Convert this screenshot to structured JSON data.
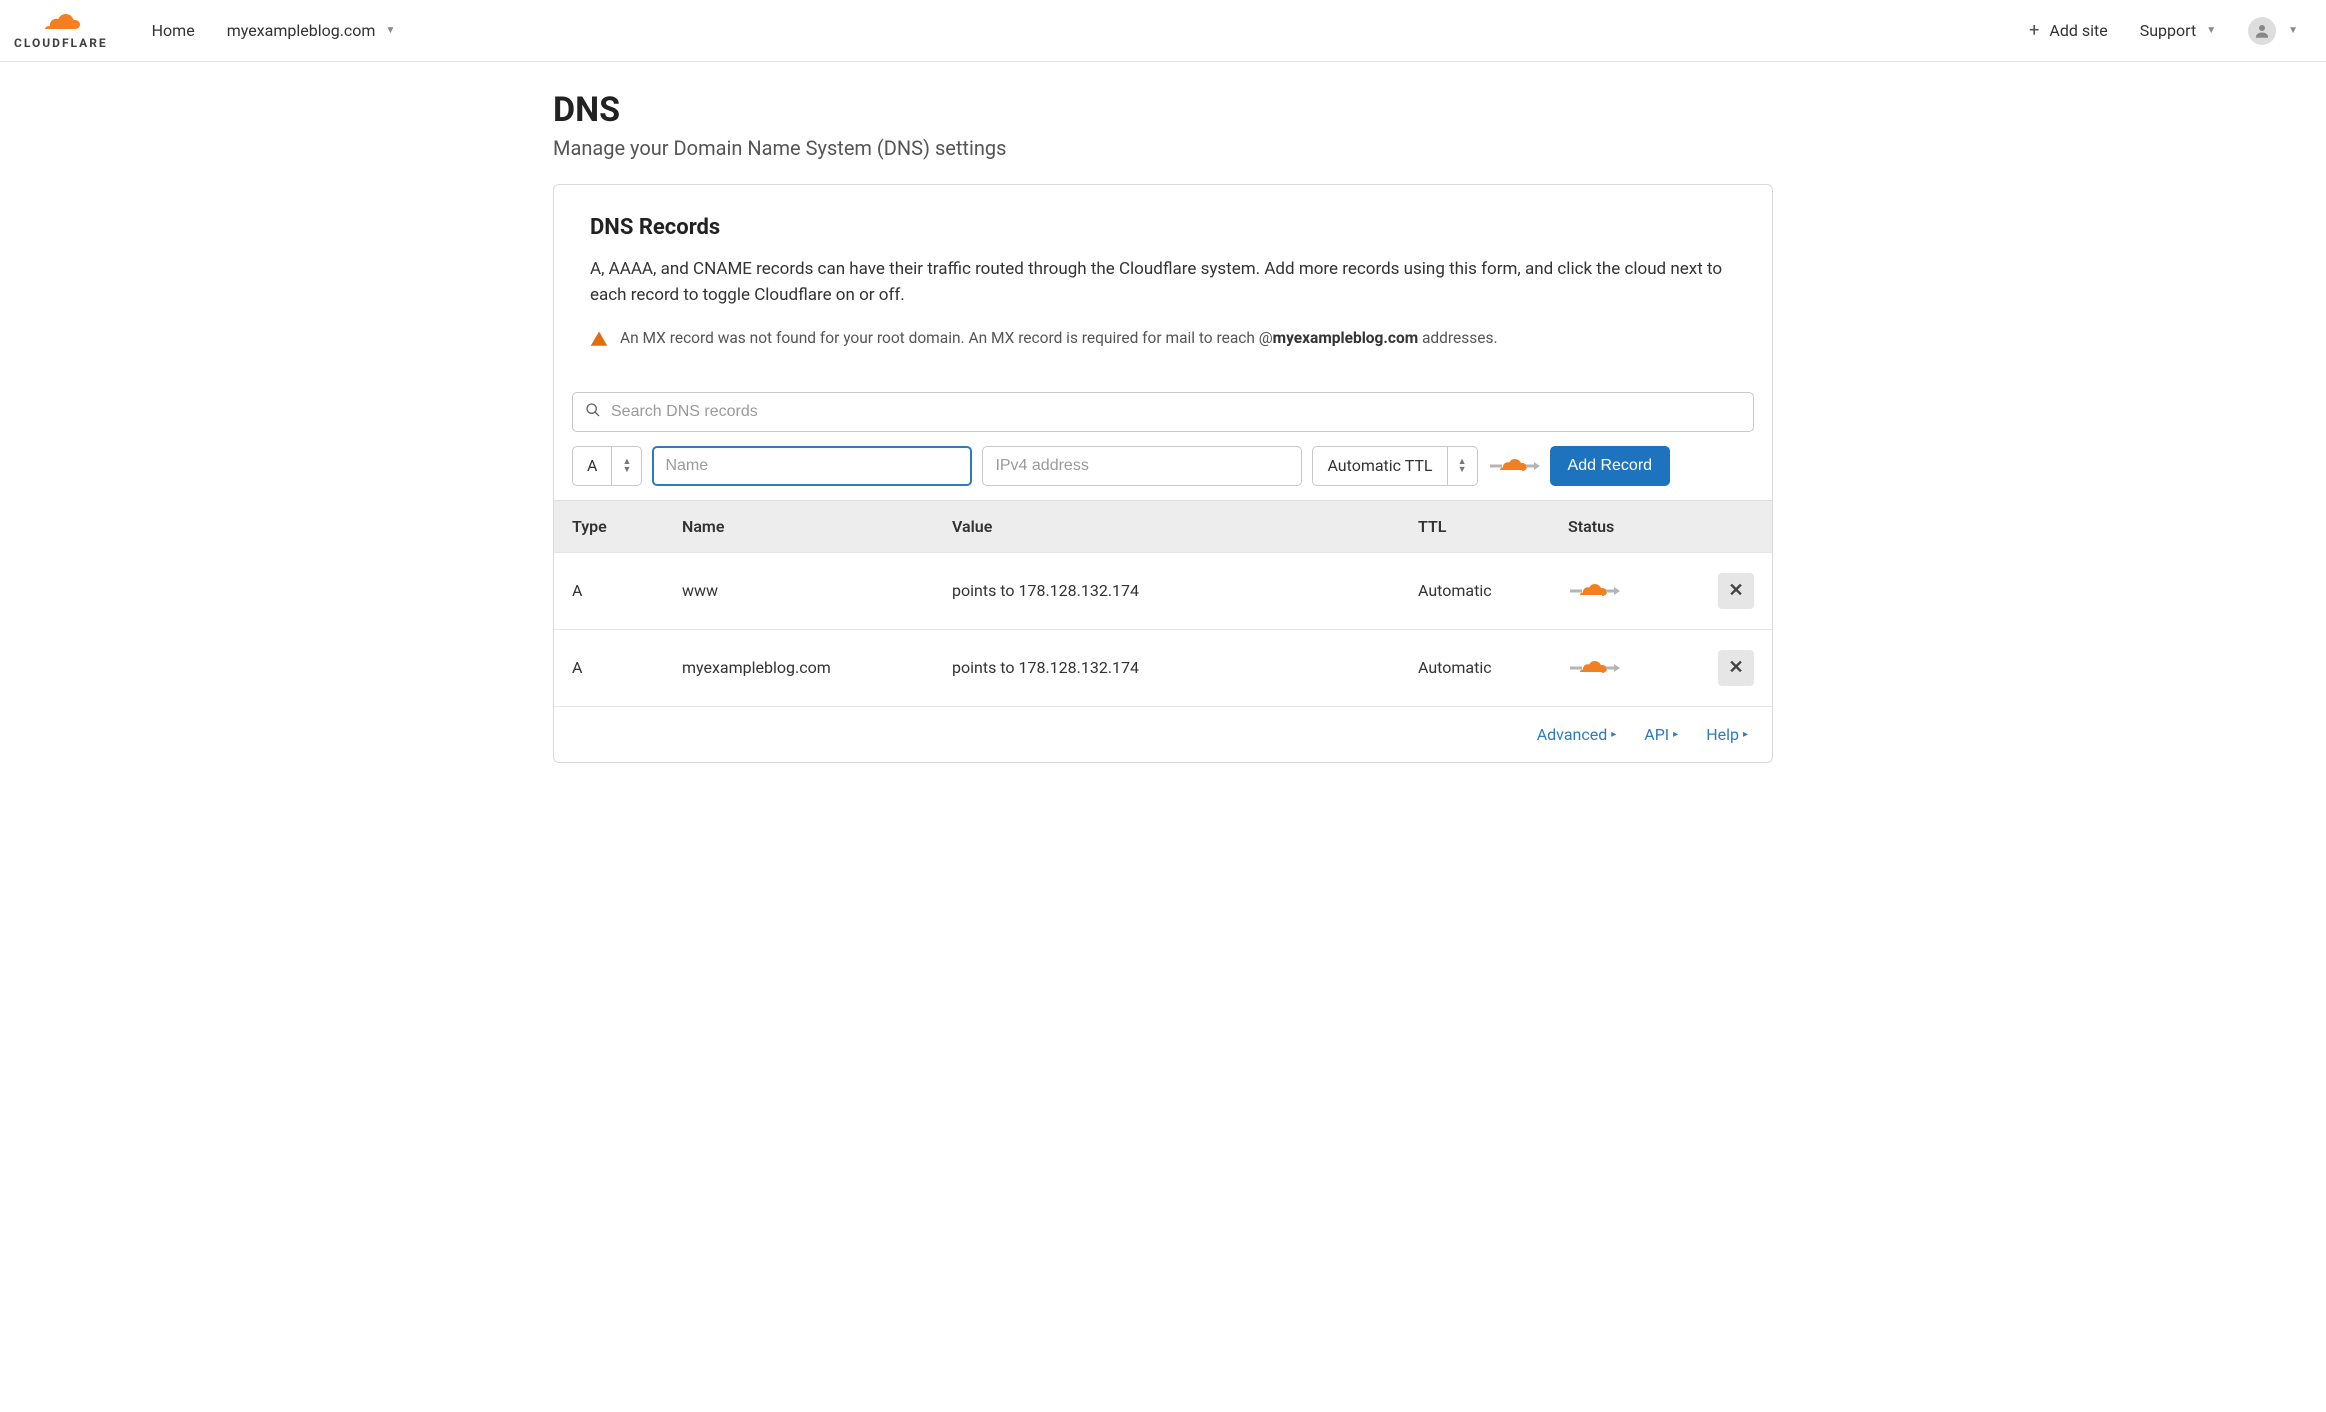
{
  "brand": {
    "name": "CLOUDFLARE"
  },
  "topnav": {
    "home": "Home",
    "site_selector": "myexampleblog.com",
    "add_site": "Add site",
    "support": "Support"
  },
  "page": {
    "title": "DNS",
    "subtitle": "Manage your Domain Name System (DNS) settings"
  },
  "panel": {
    "title": "DNS Records",
    "description": "A, AAAA, and CNAME records can have their traffic routed through the Cloudflare system. Add more records using this form, and click the cloud next to each record to toggle Cloudflare on or off.",
    "warning_prefix": "An MX record was not found for your root domain. An MX record is required for mail to reach @",
    "warning_domain": "myexampleblog.com",
    "warning_suffix": " addresses."
  },
  "search": {
    "placeholder": "Search DNS records"
  },
  "form": {
    "type_value": "A",
    "name_placeholder": "Name",
    "value_placeholder": "IPv4 address",
    "ttl_value": "Automatic TTL",
    "add_button": "Add Record"
  },
  "table": {
    "headers": {
      "type": "Type",
      "name": "Name",
      "value": "Value",
      "ttl": "TTL",
      "status": "Status"
    },
    "rows": [
      {
        "type": "A",
        "name": "www",
        "value": "points to 178.128.132.174",
        "ttl": "Automatic"
      },
      {
        "type": "A",
        "name": "myexampleblog.com",
        "value": "points to 178.128.132.174",
        "ttl": "Automatic"
      }
    ]
  },
  "footer": {
    "advanced": "Advanced",
    "api": "API",
    "help": "Help"
  }
}
